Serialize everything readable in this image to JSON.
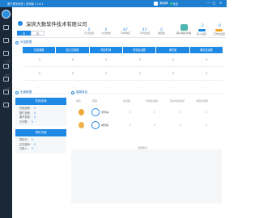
{
  "window": {
    "title": "客户服务系统 | 官网版 | 3.8.1",
    "user": "周晓静",
    "status": "在线",
    "controls": [
      "—",
      "□",
      "✕"
    ]
  },
  "header": {
    "company": "深圳大数软件技术有限公司",
    "tabs": [
      "日",
      "月"
    ],
    "stats": [
      {
        "value": "0",
        "label": "今日接待"
      },
      {
        "value": "0",
        "label": "今日新增"
      },
      {
        "value": "42'",
        "label": "平均响应"
      },
      {
        "value": "42'",
        "label": "平均会话"
      },
      {
        "value": "0",
        "label": "满意度"
      }
    ],
    "tools": [
      {
        "label": "客户联系管理",
        "value": "",
        "color": "#4db6ac"
      },
      {
        "label": "接入设置",
        "value": "2",
        "color": "#1e88e5"
      },
      {
        "label": "工作台设置",
        "value": "0",
        "color": "#f5a623"
      }
    ]
  },
  "overview": {
    "title": "对话数据",
    "columns": [
      "总接通数",
      "独立访客数",
      "响应时间",
      "有效会话数",
      "满意度",
      "满意会话数"
    ],
    "rows": [
      {
        "label": "全部",
        "cells": [
          "0",
          "0",
          "0",
          "0",
          "0",
          "0"
        ]
      },
      {
        "label": "我的",
        "cells": [
          "0",
          "0",
          "0",
          "0",
          "0",
          "0"
        ]
      },
      {
        "label": "比例",
        "cells": [
          "-",
          "-",
          "-",
          "-",
          "-",
          "-"
        ]
      }
    ]
  },
  "left_panel": {
    "title": "坐席数据",
    "section1": {
      "header": "在线坐席",
      "lines": [
        {
          "label": "在线坐席：",
          "value": "0"
        },
        {
          "label": "繁忙坐席：",
          "value": "0"
        },
        {
          "label": "离开坐席：",
          "value": "0"
        },
        {
          "label": "已分配：",
          "value": "0"
        }
      ]
    },
    "section2": {
      "header": "排队访客",
      "lines": [
        {
          "label": "排队中：",
          "value": "0"
        },
        {
          "label": "正在接待：",
          "value": "0"
        },
        {
          "label": "已接入：",
          "value": "0"
        }
      ]
    }
  },
  "right_panel": {
    "title": "客服排名",
    "columns": [
      "排名",
      "客服",
      "接待量",
      "有效会话数",
      "首次响应时间",
      "满意会话数"
    ],
    "employees": [
      {
        "name": "周晓静",
        "values": [
          "0",
          "0",
          "0",
          "0"
        ]
      },
      {
        "name": "胡晓静",
        "values": [
          "0",
          "0",
          "0",
          "0"
        ]
      }
    ],
    "more": "查看更多"
  },
  "colors": {
    "accent": "#1e88e5",
    "sidebar": "#1b2838",
    "titlebar": "#1e7fd0"
  }
}
